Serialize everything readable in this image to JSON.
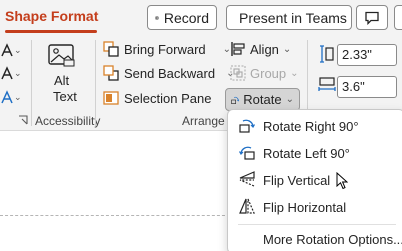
{
  "tabs": {
    "active": "Shape Format"
  },
  "header_buttons": {
    "record": "Record",
    "present_in_teams": "Present in Teams"
  },
  "ribbon": {
    "accessibility_group": {
      "alt_text": [
        "Alt",
        "Text"
      ],
      "label": "Accessibility"
    },
    "arrange_group": {
      "bring_forward": "Bring Forward",
      "send_backward": "Send Backward",
      "selection_pane": "Selection Pane",
      "align": "Align",
      "group": "Group",
      "rotate": "Rotate",
      "label": "Arrange"
    },
    "size_group": {
      "height": "2.33\"",
      "width": "3.6\""
    }
  },
  "rotate_menu": {
    "items": [
      {
        "label": "Rotate Right 90°",
        "icon": "rotate-right-icon"
      },
      {
        "label": "Rotate Left 90°",
        "icon": "rotate-left-icon"
      },
      {
        "label": "Flip Vertical",
        "icon": "flip-vertical-icon"
      },
      {
        "label": "Flip Horizontal",
        "icon": "flip-horizontal-icon"
      },
      {
        "label": "More Rotation Options...",
        "icon": ""
      }
    ]
  },
  "colors": {
    "accent": "#c43e1c",
    "icon_blue": "#1f6fc5",
    "icon_orange": "#d9822b"
  }
}
